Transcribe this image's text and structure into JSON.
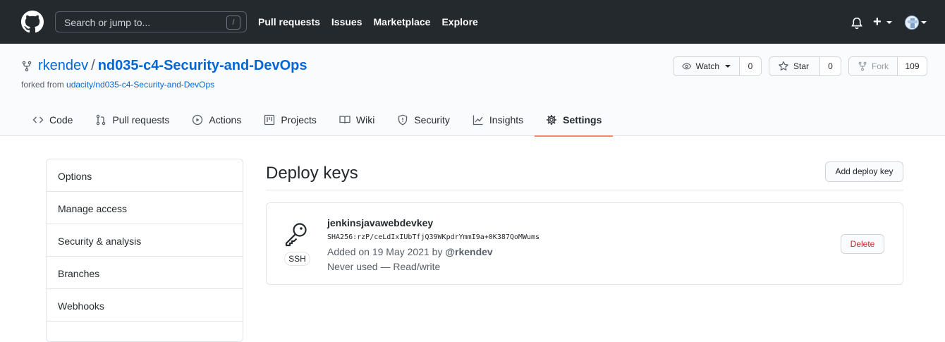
{
  "header": {
    "search_placeholder": "Search or jump to...",
    "search_shortcut": "/",
    "nav": [
      "Pull requests",
      "Issues",
      "Marketplace",
      "Explore"
    ],
    "plus": "+"
  },
  "repo": {
    "owner": "rkendev",
    "separator": "/",
    "name": "nd035-c4-Security-and-DevOps",
    "forked_prefix": "forked from ",
    "forked_from": "udacity/nd035-c4-Security-and-DevOps",
    "watch_label": "Watch",
    "watch_count": "0",
    "star_label": "Star",
    "star_count": "0",
    "fork_label": "Fork",
    "fork_count": "109",
    "tabs": [
      {
        "label": "Code"
      },
      {
        "label": "Pull requests"
      },
      {
        "label": "Actions"
      },
      {
        "label": "Projects"
      },
      {
        "label": "Wiki"
      },
      {
        "label": "Security"
      },
      {
        "label": "Insights"
      },
      {
        "label": "Settings"
      }
    ]
  },
  "sidebar": {
    "items": [
      "Options",
      "Manage access",
      "Security & analysis",
      "Branches",
      "Webhooks"
    ]
  },
  "main": {
    "title": "Deploy keys",
    "add_button": "Add deploy key",
    "key": {
      "badge": "SSH",
      "name": "jenkinsjavawebdevkey",
      "fingerprint": "SHA256:rzP/ceLdIxIUbTfjQ39WKpdrYmmI9a+0K387QoMWums",
      "added_prefix": "Added on 19 May 2021 by ",
      "added_by": "@rkendev",
      "usage": "Never used — Read/write",
      "delete_label": "Delete"
    }
  }
}
